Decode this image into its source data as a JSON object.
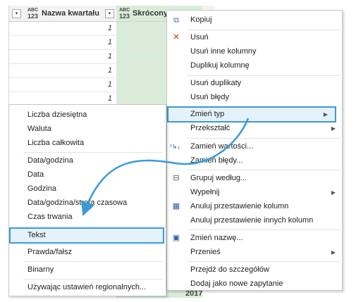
{
  "grid": {
    "col1": {
      "type_badge_top": "ABC",
      "type_badge_bottom": "123",
      "name": "Nazwa kwartału"
    },
    "col2": {
      "type_badge_top": "ABC",
      "type_badge_bottom": "123",
      "name": "Skrócony R..."
    },
    "dropdown_glyph": "▾",
    "rows": [
      "1",
      "1",
      "1",
      "1",
      "1",
      "1"
    ],
    "footer_year": "2017"
  },
  "context_menu": {
    "items": [
      {
        "label": "Kopiuj"
      },
      {
        "label": "Usuń"
      },
      {
        "label": "Usuń inne kolumny"
      },
      {
        "label": "Duplikuj kolumnę"
      },
      {
        "label": "Usuń duplikaty"
      },
      {
        "label": "Usuń błędy"
      },
      {
        "label": "Zmień typ"
      },
      {
        "label": "Przekształć"
      },
      {
        "label": "Zamień wartości..."
      },
      {
        "label": "Zamień błędy..."
      },
      {
        "label": "Grupuj według..."
      },
      {
        "label": "Wypełnij"
      },
      {
        "label": "Anuluj przestawienie kolumn"
      },
      {
        "label": "Anuluj przestawienie innych kolumn"
      },
      {
        "label": "Zmień nazwę..."
      },
      {
        "label": "Przenieś"
      },
      {
        "label": "Przejdź do szczegółów"
      },
      {
        "label": "Dodaj jako nowe zapytanie"
      }
    ]
  },
  "type_submenu": {
    "items": [
      {
        "label": "Liczba dziesiętna"
      },
      {
        "label": "Waluta"
      },
      {
        "label": "Liczba całkowita"
      },
      {
        "label": "Data/godzina"
      },
      {
        "label": "Data"
      },
      {
        "label": "Godzina"
      },
      {
        "label": "Data/godzina/strefa czasowa"
      },
      {
        "label": "Czas trwania"
      },
      {
        "label": "Tekst"
      },
      {
        "label": "Prawda/fałsz"
      },
      {
        "label": "Binarny"
      },
      {
        "label": "Używając ustawień regionalnych..."
      }
    ]
  },
  "colors": {
    "highlight_border": "#3a9ad9",
    "highlight_fill": "#e5f1fb",
    "column_fill": "#d9ecd9",
    "arrow": "#3a9ad9"
  }
}
